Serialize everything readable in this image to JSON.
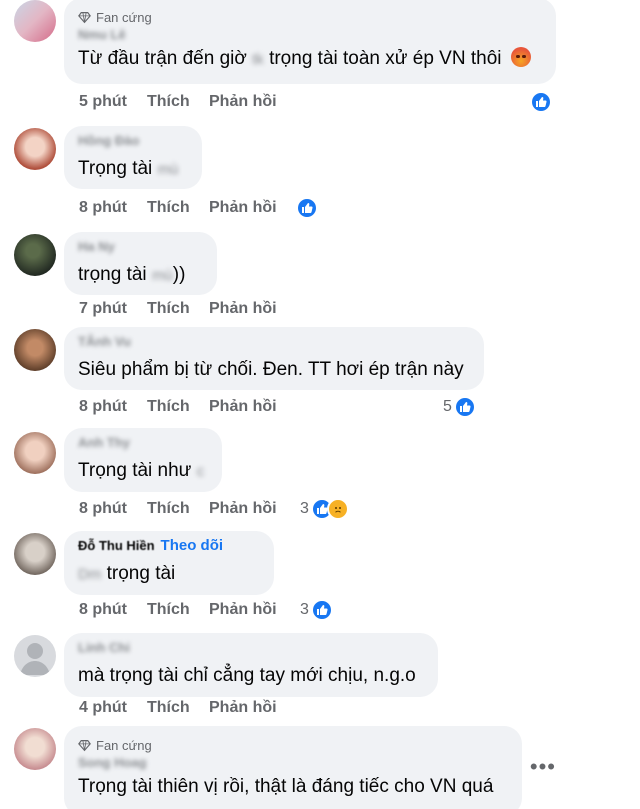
{
  "comments": [
    {
      "badge": "Fan cứng",
      "author": "Nmu Lê",
      "text": "Từ đầu trận đến giờ",
      "redacted": "tk",
      "text_after": "trọng tài toàn xử ép VN thôi",
      "time": "5 phút",
      "like": "Thích",
      "reply": "Phản hồi",
      "reaction_count": ""
    },
    {
      "author": "Hồng Đào",
      "text": "Trọng tài",
      "redacted": "mù",
      "time": "8 phút",
      "like": "Thích",
      "reply": "Phản hồi",
      "reaction_count": ""
    },
    {
      "author": "Ha Ny",
      "text": "trọng tài",
      "redacted": "mù",
      "text_after": "))",
      "time": "7 phút",
      "like": "Thích",
      "reply": "Phản hồi"
    },
    {
      "author": "TÂnh Vu",
      "author_visible_tail": "u",
      "text": "Siêu phẩm bị từ chối. Đen. TT hơi ép trận này",
      "time": "8 phút",
      "like": "Thích",
      "reply": "Phản hồi",
      "reaction_count": "5"
    },
    {
      "author": "Anh Thy",
      "text": "Trọng tài như",
      "redacted": "c",
      "time": "8 phút",
      "like": "Thích",
      "reply": "Phản hồi",
      "reaction_count": "3"
    },
    {
      "author": "Đỗ Thu Hiền",
      "follow": "Theo dõi",
      "redacted": "Dm",
      "text": "trọng tài",
      "time": "8 phút",
      "like": "Thích",
      "reply": "Phản hồi",
      "reaction_count": "3"
    },
    {
      "author": "Linh Chi",
      "text": "mà trọng tài chỉ cẳng tay mới chịu, n.g.o",
      "time": "4 phút",
      "like": "Thích",
      "reply": "Phản hồi"
    },
    {
      "badge": "Fan cứng",
      "author": "Song Hoag",
      "text": "Trọng tài thiên vị rồi, thật là đáng tiếc cho VN quá",
      "more": "•••"
    }
  ],
  "colors": {
    "accent": "#1877f2",
    "bubble": "#f0f2f5",
    "meta": "#65676b"
  },
  "icons": [
    "diamond-icon",
    "like-reaction-icon",
    "sad-reaction-icon",
    "angry-emoji-icon",
    "more-options-icon"
  ]
}
